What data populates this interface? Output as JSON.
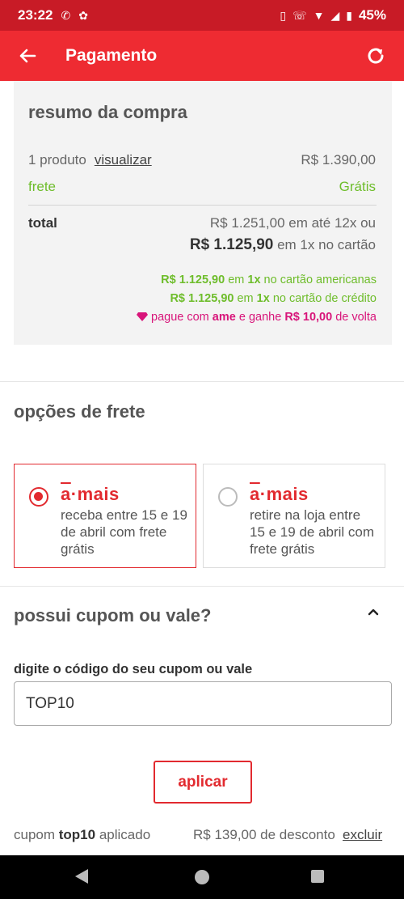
{
  "status_bar": {
    "time": "23:22",
    "battery": "45%",
    "icons": [
      "whatsapp-icon",
      "notification-icon",
      "vibrate-icon",
      "wifi-call-icon",
      "wifi-icon",
      "signal-icon",
      "battery-icon"
    ]
  },
  "app_bar": {
    "title": "Pagamento",
    "back_icon": "arrow-left-icon",
    "refresh_icon": "refresh-icon"
  },
  "summary": {
    "title": "resumo da compra",
    "products_label": "1 produto",
    "view_link": "visualizar",
    "products_price": "R$ 1.390,00",
    "shipping_label": "frete",
    "shipping_value": "Grátis",
    "total_label": "total",
    "installments_text": "R$ 1.251,00 em até 12x ou",
    "cash_price": "R$ 1.125,90",
    "cash_suffix": " em 1x no cartão",
    "offer1": {
      "price": "R$ 1.125,90",
      "mid": " em ",
      "times": "1x",
      "text": " no cartão americanas"
    },
    "offer2": {
      "price": "R$ 1.125,90",
      "mid": " em ",
      "times": "1x",
      "text": " no cartão de crédito"
    },
    "offer3": {
      "pre": "pague com ",
      "brand": "ame",
      "mid": " e ganhe ",
      "amount": "R$ 10,00",
      "post": " de volta"
    }
  },
  "shipping": {
    "title": "opções de frete",
    "options": [
      {
        "brand_a": "a",
        "brand_rest": "·mais",
        "desc": "receba entre 15 e 19 de abril com frete grátis",
        "selected": true
      },
      {
        "brand_a": "a",
        "brand_rest": "·mais",
        "desc": "retire na loja entre 15 e 19 de abril com frete grátis",
        "selected": false
      }
    ]
  },
  "coupon": {
    "title": "possui cupom ou vale?",
    "field_label": "digite o código do seu cupom ou vale",
    "value": "TOP10",
    "apply_label": "aplicar",
    "status_pre": "cupom ",
    "status_code": "top10",
    "status_post": " aplicado",
    "discount": "R$ 139,00 de desconto",
    "remove_label": "excluir"
  },
  "colors": {
    "brand_red": "#ee2b32",
    "accent_red": "#e22a2f",
    "green": "#6ebd2b",
    "ame_pink": "#d8157a"
  }
}
